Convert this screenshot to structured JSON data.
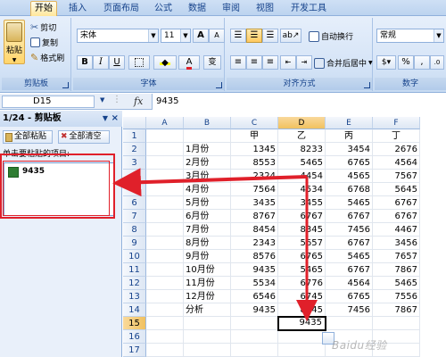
{
  "tabs": [
    {
      "label": "开始",
      "active": true
    },
    {
      "label": "插入",
      "active": false
    },
    {
      "label": "页面布局",
      "active": false
    },
    {
      "label": "公式",
      "active": false
    },
    {
      "label": "数据",
      "active": false
    },
    {
      "label": "审阅",
      "active": false
    },
    {
      "label": "视图",
      "active": false
    },
    {
      "label": "开发工具",
      "active": false
    }
  ],
  "ribbon": {
    "clipboard": {
      "paste": "粘贴",
      "cut": "剪切",
      "copy": "复制",
      "format_painter": "格式刷",
      "label": "剪贴板"
    },
    "font": {
      "name": "宋体",
      "size": "11",
      "bold": "B",
      "italic": "I",
      "underline": "U",
      "grow": "A",
      "shrink": "A",
      "color_letter": "A",
      "phonetic": "变",
      "label": "字体"
    },
    "alignment": {
      "wrap": "自动换行",
      "merge": "合并后居中",
      "label": "对齐方式"
    },
    "number": {
      "format": "常规",
      "percent": "%",
      "comma": ",",
      "label": "数字"
    }
  },
  "formula_bar": {
    "name_box": "D15",
    "fx": "fx",
    "value": "9435"
  },
  "clipboard_pane": {
    "title": "1/24 - 剪贴板",
    "close": "×",
    "menu_arrow": "▼",
    "paste_all": "全部粘贴",
    "clear_all": "全部清空",
    "hint": "单击要粘贴的项目:",
    "items": [
      "9435"
    ]
  },
  "sheet": {
    "columns": [
      "A",
      "B",
      "C",
      "D",
      "E",
      "F"
    ],
    "selected_column": "D",
    "rows": [
      {
        "n": "1",
        "b": "",
        "c": "甲",
        "d": "乙",
        "e": "丙",
        "f": "丁"
      },
      {
        "n": "2",
        "b": "1月份",
        "c": "1345",
        "d": "8233",
        "e": "3454",
        "f": "2676"
      },
      {
        "n": "3",
        "b": "2月份",
        "c": "8553",
        "d": "5465",
        "e": "6765",
        "f": "4564"
      },
      {
        "n": "4",
        "b": "3月份",
        "c": "2324",
        "d": "4454",
        "e": "4565",
        "f": "7567"
      },
      {
        "n": "5",
        "b": "4月份",
        "c": "7564",
        "d": "4534",
        "e": "6768",
        "f": "5645"
      },
      {
        "n": "6",
        "b": "5月份",
        "c": "3435",
        "d": "3455",
        "e": "5465",
        "f": "6767"
      },
      {
        "n": "7",
        "b": "6月份",
        "c": "8767",
        "d": "6767",
        "e": "6767",
        "f": "6767"
      },
      {
        "n": "8",
        "b": "7月份",
        "c": "8454",
        "d": "8345",
        "e": "7456",
        "f": "4467"
      },
      {
        "n": "9",
        "b": "8月份",
        "c": "2343",
        "d": "5657",
        "e": "6767",
        "f": "3456"
      },
      {
        "n": "10",
        "b": "9月份",
        "c": "8576",
        "d": "6765",
        "e": "5465",
        "f": "7657"
      },
      {
        "n": "11",
        "b": "10月份",
        "c": "9435",
        "d": "5465",
        "e": "6767",
        "f": "7867"
      },
      {
        "n": "12",
        "b": "11月份",
        "c": "5534",
        "d": "6776",
        "e": "4564",
        "f": "5465"
      },
      {
        "n": "13",
        "b": "12月份",
        "c": "6546",
        "d": "6745",
        "e": "6765",
        "f": "7556"
      },
      {
        "n": "14",
        "b": "分析",
        "c": "9435",
        "d": "8345",
        "e": "7456",
        "f": "7867"
      },
      {
        "n": "15",
        "b": "",
        "c": "",
        "d": "9435",
        "e": "",
        "f": ""
      },
      {
        "n": "16",
        "b": "",
        "c": "",
        "d": "",
        "e": "",
        "f": ""
      },
      {
        "n": "17",
        "b": "",
        "c": "",
        "d": "",
        "e": "",
        "f": ""
      }
    ],
    "selected_row": "15"
  },
  "watermark": "Baidu经验",
  "colors": {
    "annotation": "#e0202a",
    "ribbon_text": "#15428b"
  }
}
